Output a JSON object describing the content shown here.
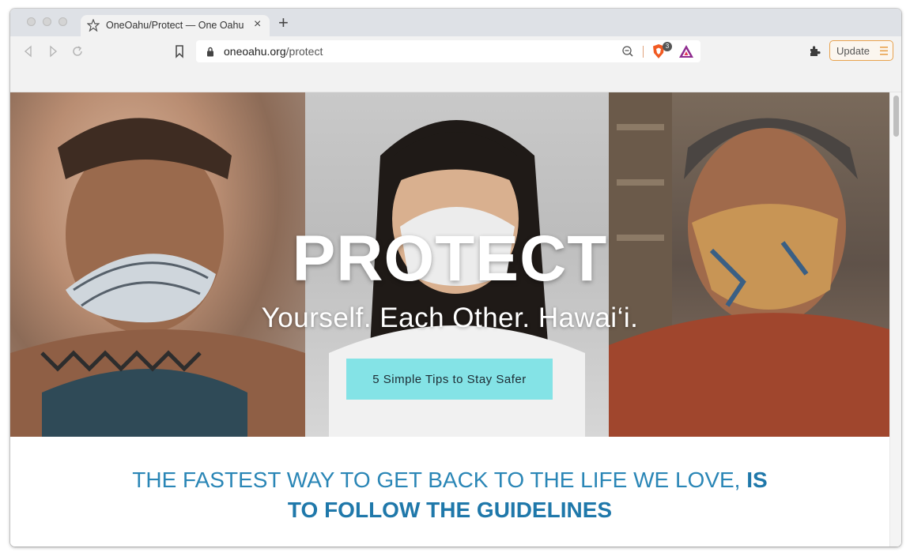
{
  "browser": {
    "tab": {
      "title": "OneOahu/Protect — One Oahu",
      "close": "×"
    },
    "new_tab": "+",
    "url": {
      "domain": "oneoahu.org",
      "path": "/protect"
    },
    "brave_shield_count": "3",
    "update_label": "Update",
    "colors": {
      "update_border": "#e8a24e",
      "brave_orange": "#f15a22"
    },
    "icons": [
      "back-icon",
      "forward-icon",
      "reload-icon",
      "bookmark-icon",
      "lock-icon",
      "zoom-out-icon",
      "brave-shield-icon",
      "brave-rewards-icon",
      "extensions-icon",
      "menu-icon"
    ]
  },
  "hero": {
    "title": "PROTECT",
    "subtitle": "Yourself. Each Other. Hawai‘i.",
    "cta_label": "5 Simple Tips to Stay Safer",
    "colors": {
      "cta_bg": "#84e3e6"
    }
  },
  "tagline": {
    "normal": "THE FASTEST WAY TO GET BACK TO THE LIFE WE LOVE, ",
    "bold_1": "IS",
    "bold_2": "TO FOLLOW THE GUIDELINES",
    "colors": {
      "text": "#2a86b6"
    }
  }
}
